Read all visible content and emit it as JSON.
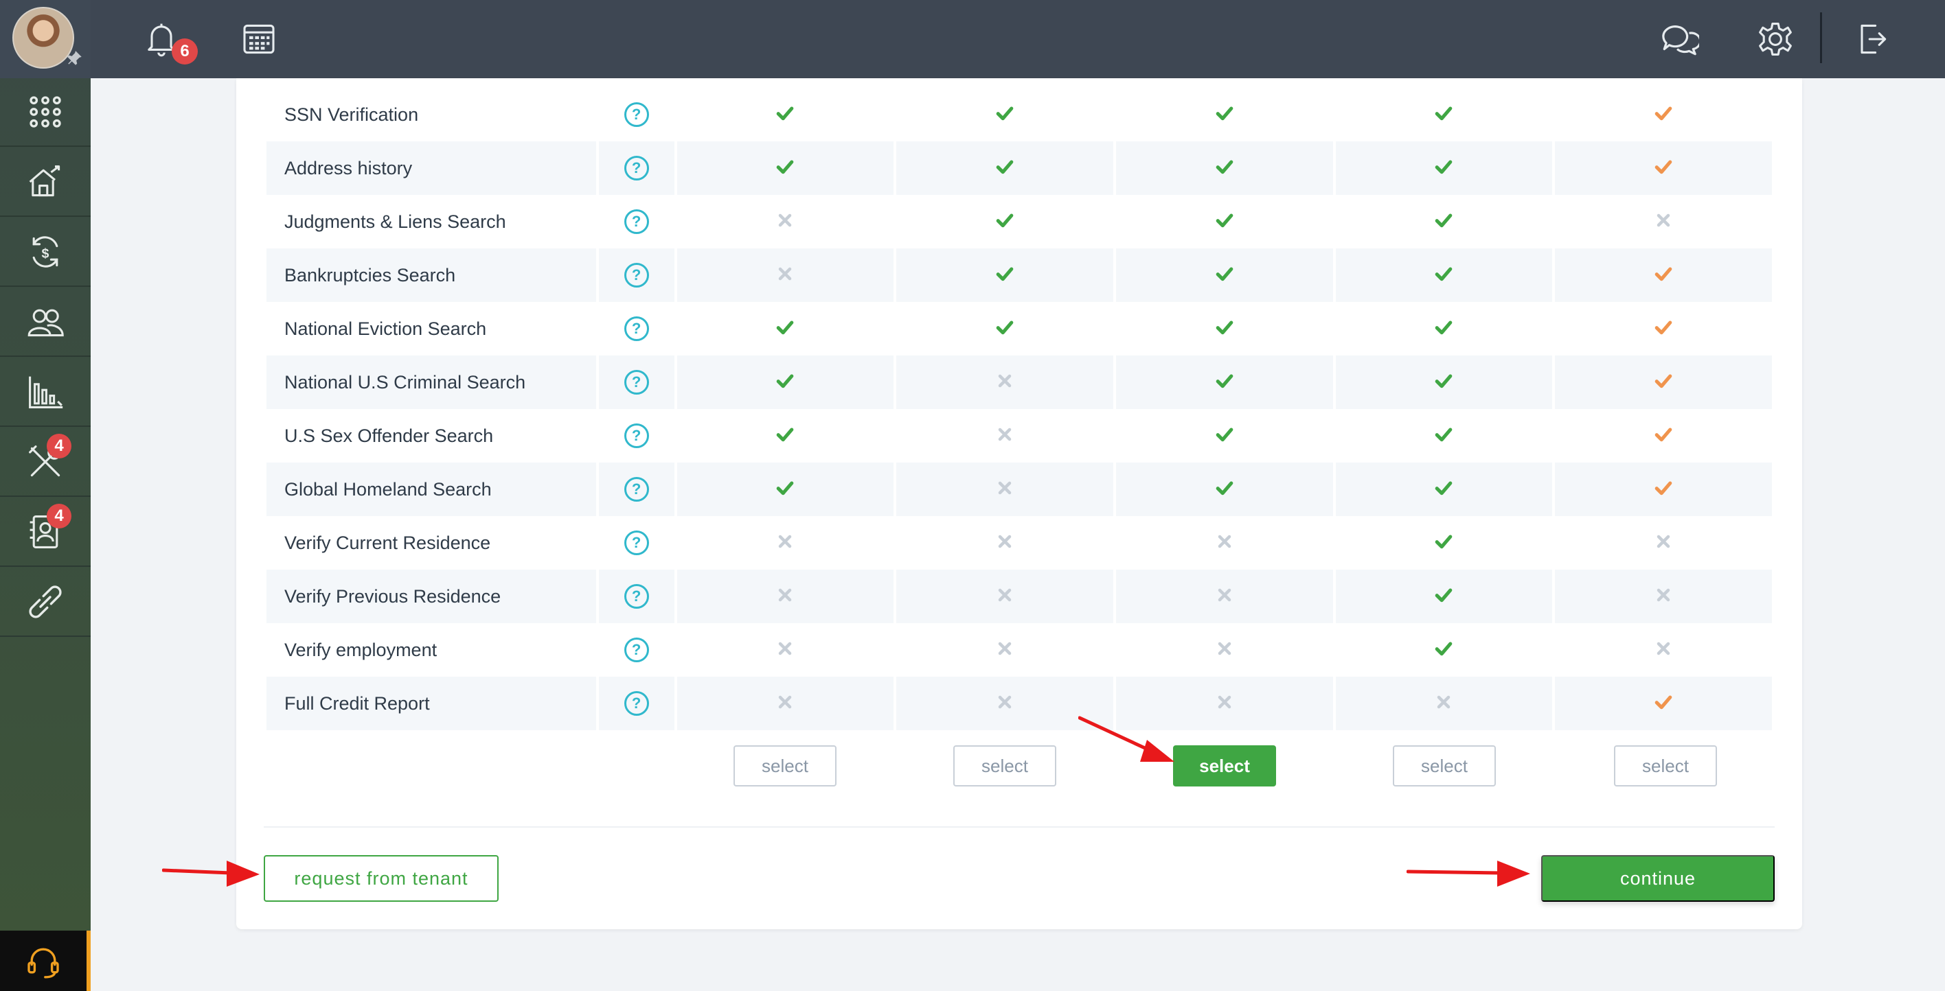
{
  "app": {
    "notifications_count": "6",
    "tools_badge": "4",
    "applicants_badge": "4"
  },
  "sidebar": {
    "items": [
      {
        "icon": "apps-grid-icon"
      },
      {
        "icon": "properties-icon"
      },
      {
        "icon": "payments-icon"
      },
      {
        "icon": "tenants-icon"
      },
      {
        "icon": "reports-icon"
      },
      {
        "icon": "tools-icon",
        "badge": "4"
      },
      {
        "icon": "applicants-icon",
        "badge": "4"
      },
      {
        "icon": "link-icon"
      }
    ]
  },
  "features": [
    {
      "label": "SSN Verification",
      "packages": [
        "check",
        "check",
        "check",
        "check",
        "partial"
      ]
    },
    {
      "label": "Address history",
      "packages": [
        "check",
        "check",
        "check",
        "check",
        "partial"
      ]
    },
    {
      "label": "Judgments & Liens Search",
      "packages": [
        "cross",
        "check",
        "check",
        "check",
        "cross"
      ]
    },
    {
      "label": "Bankruptcies Search",
      "packages": [
        "cross",
        "check",
        "check",
        "check",
        "partial"
      ]
    },
    {
      "label": "National Eviction Search",
      "packages": [
        "check",
        "check",
        "check",
        "check",
        "partial"
      ]
    },
    {
      "label": "National U.S Criminal Search",
      "packages": [
        "check",
        "cross",
        "check",
        "check",
        "partial"
      ]
    },
    {
      "label": "U.S Sex Offender Search",
      "packages": [
        "check",
        "cross",
        "check",
        "check",
        "partial"
      ]
    },
    {
      "label": "Global Homeland Search",
      "packages": [
        "check",
        "cross",
        "check",
        "check",
        "partial"
      ]
    },
    {
      "label": "Verify Current Residence",
      "packages": [
        "cross",
        "cross",
        "cross",
        "check",
        "cross"
      ]
    },
    {
      "label": "Verify Previous Residence",
      "packages": [
        "cross",
        "cross",
        "cross",
        "check",
        "cross"
      ]
    },
    {
      "label": "Verify employment",
      "packages": [
        "cross",
        "cross",
        "cross",
        "check",
        "cross"
      ]
    },
    {
      "label": "Full Credit Report",
      "packages": [
        "cross",
        "cross",
        "cross",
        "cross",
        "partial"
      ]
    }
  ],
  "select_buttons": [
    "select",
    "select",
    "select",
    "select",
    "select"
  ],
  "selected_package_index": 2,
  "actions": {
    "request_label": "request from tenant",
    "continue_label": "continue"
  },
  "colors": {
    "check": "#3fa643",
    "partial": "#f0944d",
    "cross": "#c7ced6",
    "accent": "#3fa643",
    "help": "#30b8cc"
  }
}
